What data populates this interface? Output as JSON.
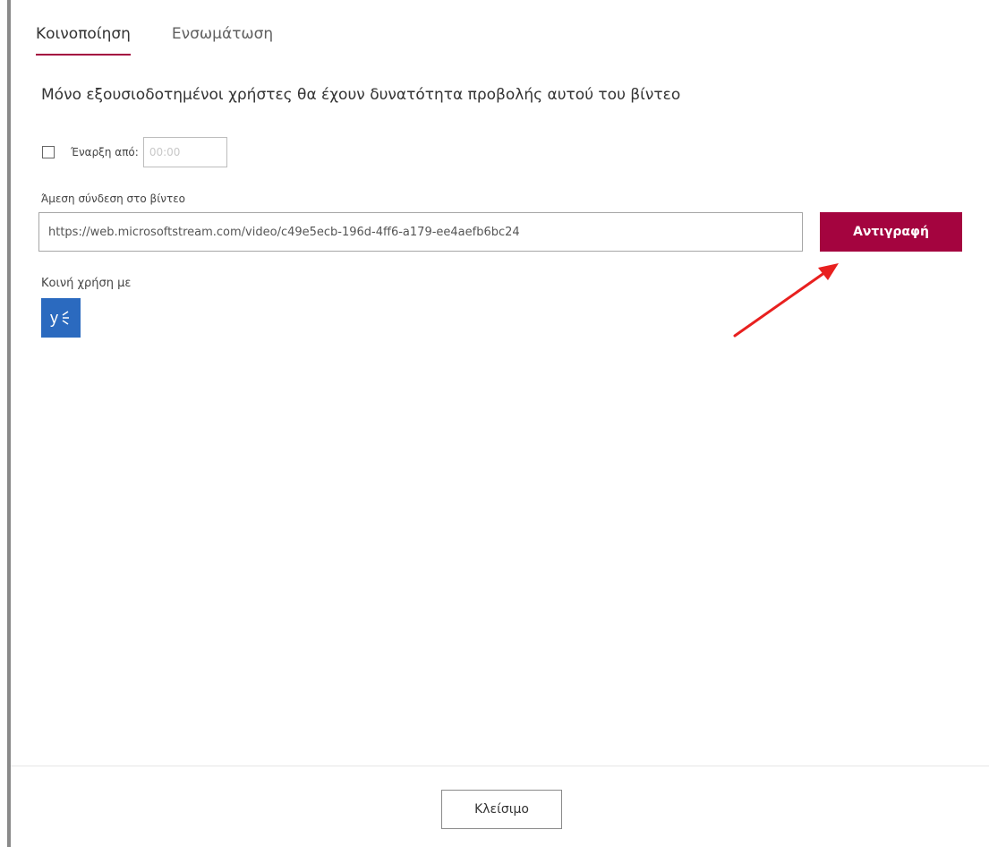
{
  "tabs": [
    {
      "label": "Κοινοποίηση",
      "active": true
    },
    {
      "label": "Ενσωμάτωση",
      "active": false
    }
  ],
  "share": {
    "info_text": "Μόνο εξουσιοδοτημένοι χρήστες θα έχουν δυνατότητα προβολής αυτού του βίντεο",
    "start_checkbox_checked": false,
    "start_label": "Έναρξη από:",
    "start_time_placeholder": "00:00",
    "link_label": "Άμεση σύνδεση στο βίντεο",
    "link_url": "https://web.microsoftstream.com/video/c49e5ecb-196d-4ff6-a179-ee4aefb6bc24",
    "copy_label": "Αντιγραφή",
    "share_with_label": "Κοινή χρήση με",
    "share_targets": [
      {
        "icon": "yammer-icon"
      }
    ]
  },
  "footer": {
    "close_label": "Κλείσιμο"
  },
  "annotation": {
    "arrow_color": "#e8201f"
  },
  "colors": {
    "accent": "#a4043f",
    "yammer": "#2b6abf"
  }
}
